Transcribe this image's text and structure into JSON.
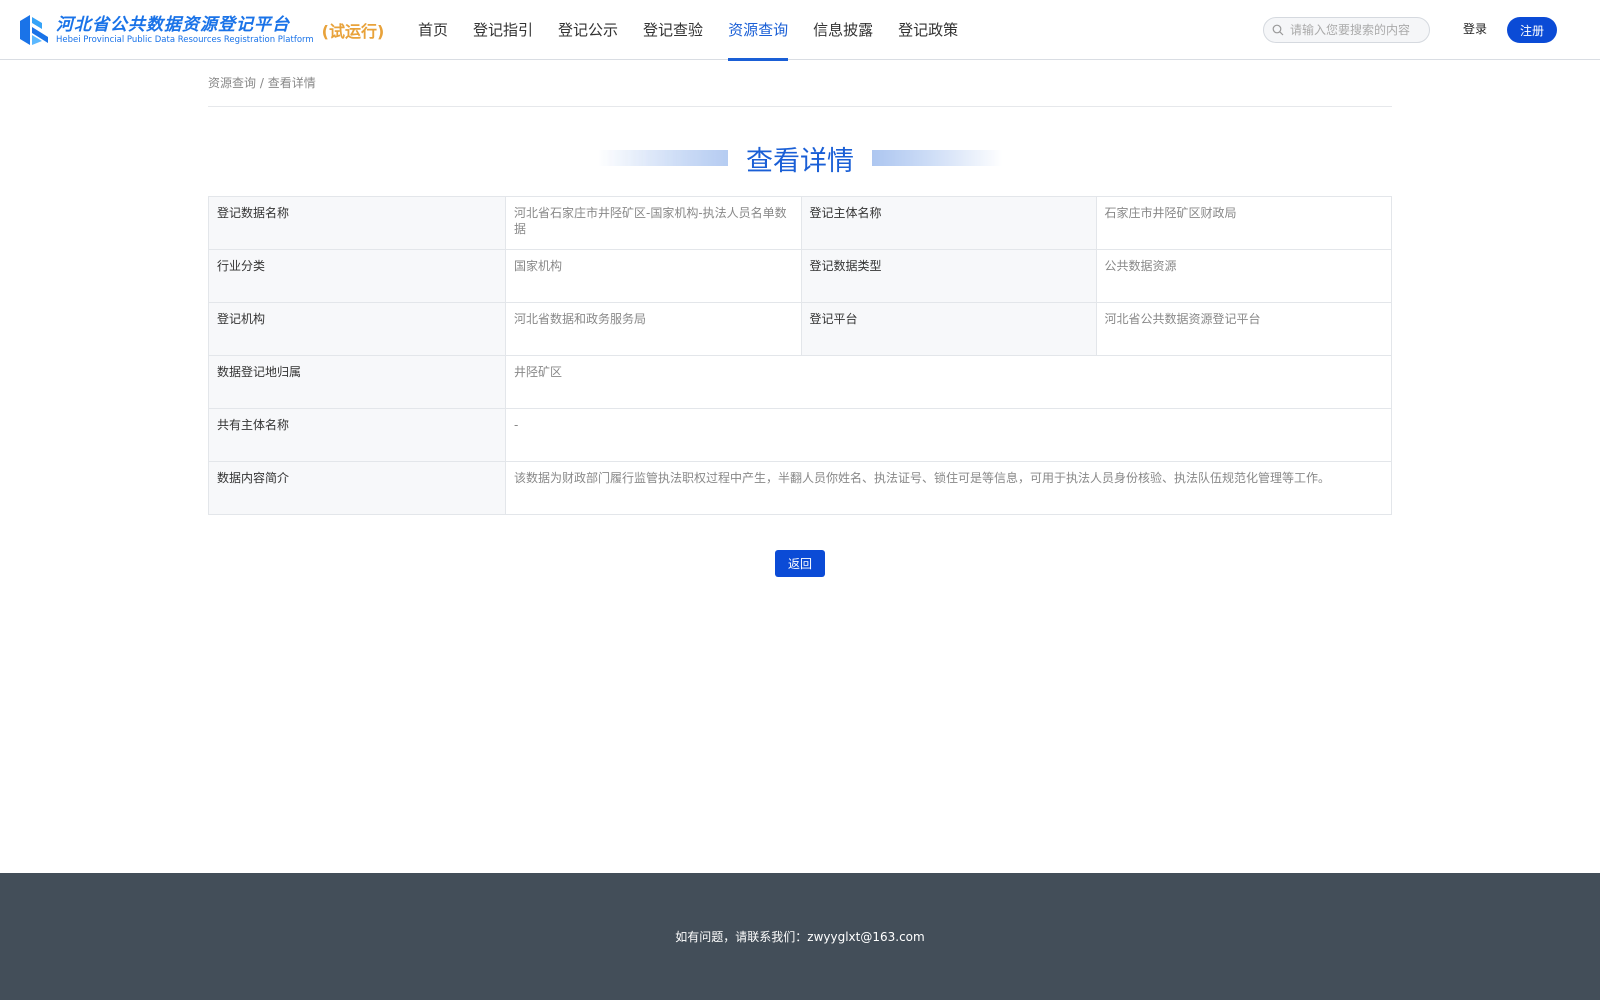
{
  "header": {
    "logo_title": "河北省公共数据资源登记平台",
    "logo_subtitle": "Hebei Provincial Public Data Resources Registration Platform",
    "logo_trial": "(试运行)",
    "nav": [
      {
        "label": "首页"
      },
      {
        "label": "登记指引"
      },
      {
        "label": "登记公示"
      },
      {
        "label": "登记查验"
      },
      {
        "label": "资源查询",
        "active": true
      },
      {
        "label": "信息披露"
      },
      {
        "label": "登记政策"
      }
    ],
    "search_placeholder": "请输入您要搜索的内容",
    "login_label": "登录",
    "register_label": "注册"
  },
  "breadcrumb": {
    "parent": "资源查询",
    "separator": " / ",
    "current": "查看详情"
  },
  "page_title": "查看详情",
  "details": {
    "row1": {
      "label1": "登记数据名称",
      "value1": "河北省石家庄市井陉矿区-国家机构-执法人员名单数据",
      "label2": "登记主体名称",
      "value2": "石家庄市井陉矿区财政局"
    },
    "row2": {
      "label1": "行业分类",
      "value1": "国家机构",
      "label2": "登记数据类型",
      "value2": "公共数据资源"
    },
    "row3": {
      "label1": "登记机构",
      "value1": "河北省数据和政务服务局",
      "label2": "登记平台",
      "value2": "河北省公共数据资源登记平台"
    },
    "row4": {
      "label": "数据登记地归属",
      "value": "井陉矿区"
    },
    "row5": {
      "label": "共有主体名称",
      "value": "-"
    },
    "row6": {
      "label": "数据内容简介",
      "value": "该数据为财政部门履行监管执法职权过程中产生，半翻人员你姓名、执法证号、锁住可是等信息，可用于执法人员身份核验、执法队伍规范化管理等工作。"
    }
  },
  "back_label": "返回",
  "footer_text": "如有问题，请联系我们：zwyyglxt@163.com",
  "colors": {
    "accent": "#1a5fd6",
    "button": "#0b4bd6",
    "trial": "#e8a23a",
    "footer_bg": "#434e59"
  }
}
